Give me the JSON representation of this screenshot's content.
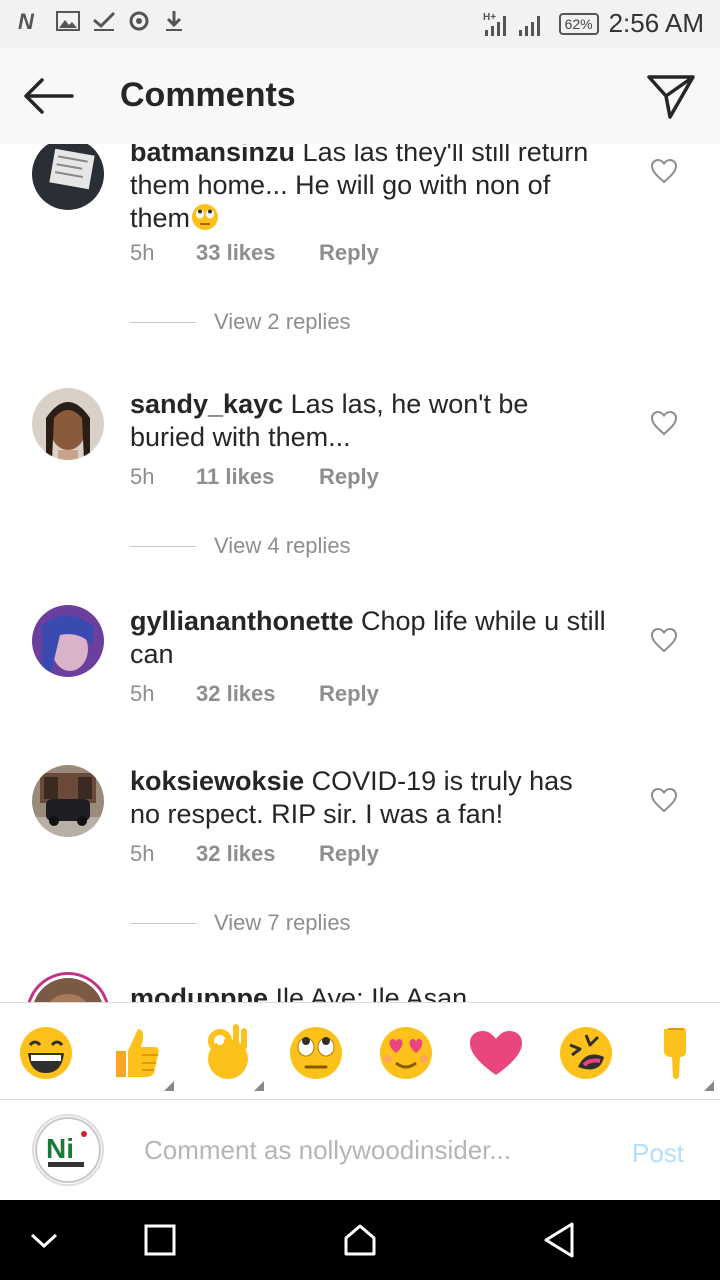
{
  "status_bar": {
    "icons": [
      "netflix-n-icon",
      "gallery-icon",
      "check-icon",
      "whatsapp-icon",
      "download-icon"
    ],
    "network": "H+",
    "battery": "62%",
    "time": "2:56 AM"
  },
  "header": {
    "title": "Comments",
    "back_icon": "back-arrow-icon",
    "share_icon": "send-icon"
  },
  "comments": [
    {
      "username": "batmansinzu",
      "text": "Las las they'll still return them home... He will go with non of them",
      "emoji": "rolling-eyes",
      "time": "5h",
      "likes": "33 likes",
      "reply": "Reply",
      "view_replies": "View 2 replies"
    },
    {
      "username": "sandy_kayc",
      "text": "Las las, he won't be buried with them...",
      "time": "5h",
      "likes": "11 likes",
      "reply": "Reply",
      "view_replies": "View 4 replies"
    },
    {
      "username": "gylliananthonette",
      "text": "Chop life while u still can",
      "time": "5h",
      "likes": "32 likes",
      "reply": "Reply"
    },
    {
      "username": "koksiewoksie",
      "text": "COVID-19 is truly has no respect. RIP sir. I was a fan!",
      "time": "5h",
      "likes": "32 likes",
      "reply": "Reply",
      "view_replies": "View 7 replies"
    },
    {
      "username": "modupppe",
      "text": "Ile Aye: Ile Asan"
    }
  ],
  "emoji_bar": [
    "grinning-face",
    "thumbs-up",
    "ok-hand",
    "rolling-eyes",
    "heart-eyes",
    "heart",
    "squinting-laugh",
    "point-down"
  ],
  "composer": {
    "placeholder": "Comment as nollywoodinsider...",
    "post_label": "Post",
    "avatar_text": "Ni"
  },
  "colors": {
    "text": "#262626",
    "meta": "#8e8e8e",
    "post_disabled": "#b2dffc",
    "heart": "#e8467c",
    "emoji_yellow": "#fcc21b"
  }
}
